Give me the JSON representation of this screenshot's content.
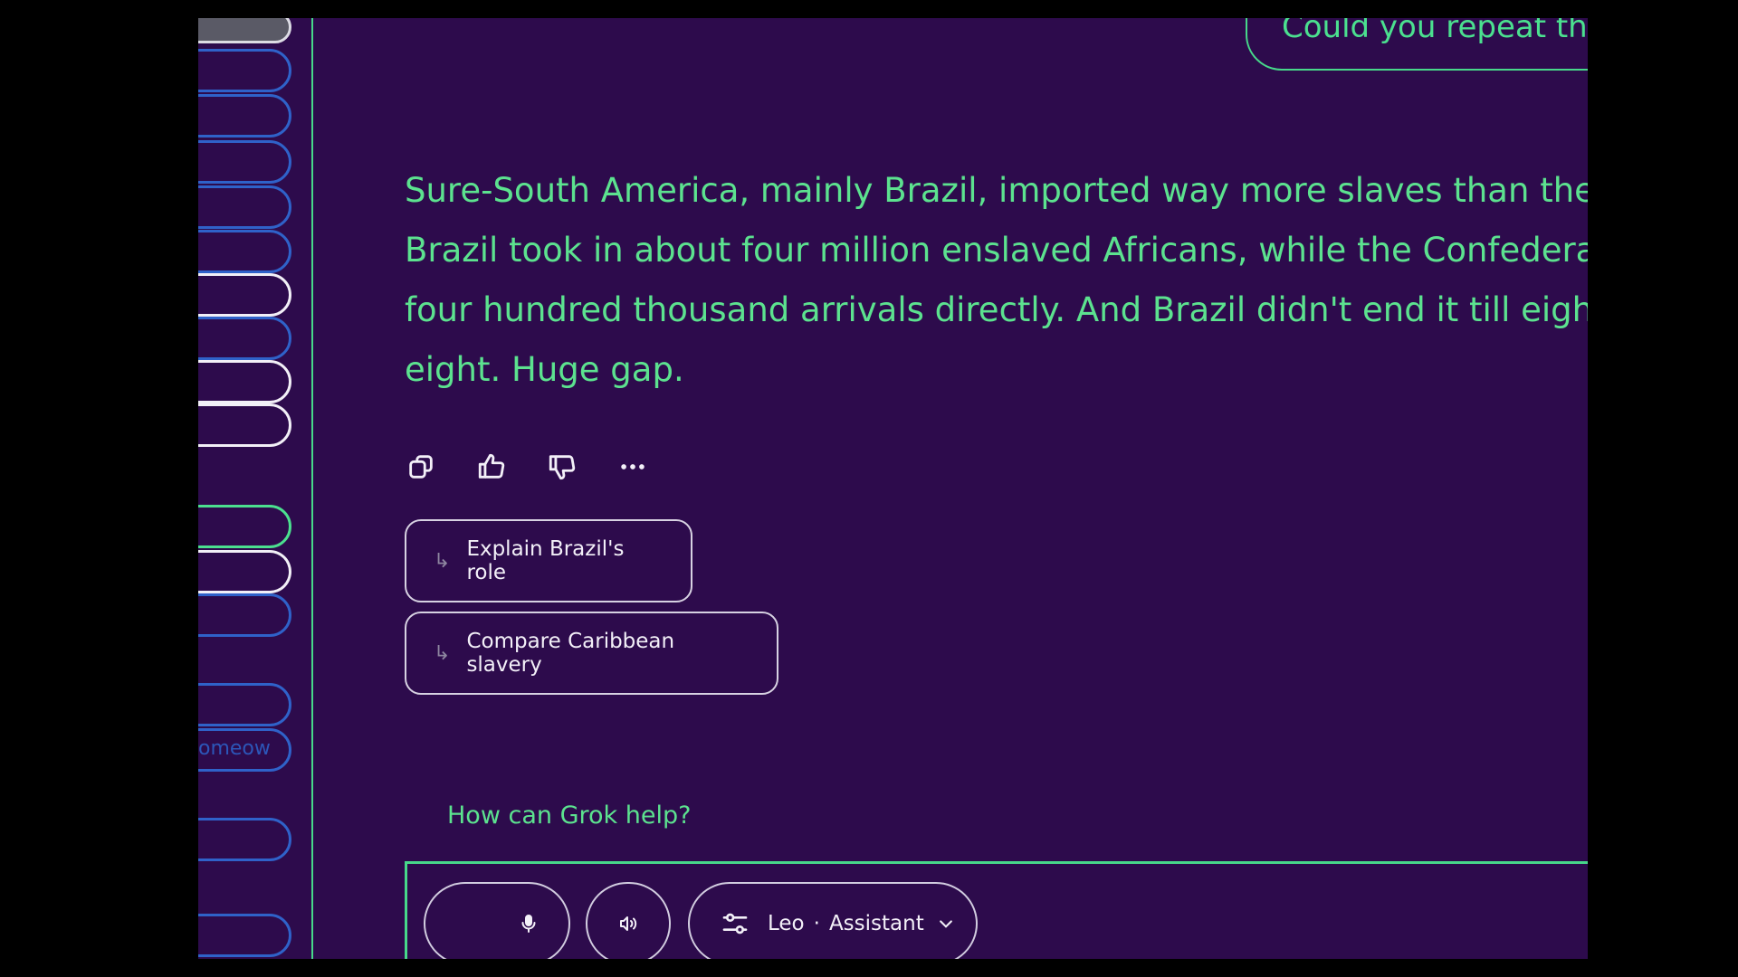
{
  "conversation": {
    "user_message": "Could you repeat th",
    "assistant_reply": [
      "Sure-South America, mainly Brazil, imported way more slaves than the Conf",
      "Brazil took in about four million enslaved Africans, while the Confederacy sa",
      "four hundred thousand arrivals directly. And Brazil didn't end it till eighteen",
      "eight. Huge gap."
    ]
  },
  "actions": {
    "copy_icon": "copy-icon",
    "like_icon": "thumbs-up-icon",
    "dislike_icon": "thumbs-down-icon",
    "more_icon": "more-icon"
  },
  "suggestions": [
    {
      "label": "Explain Brazil's role"
    },
    {
      "label": "Compare Caribbean slavery"
    }
  ],
  "composer": {
    "placeholder": "How can Grok help?",
    "persona": "Leo",
    "mode": "Assistant"
  },
  "sidebar": {
    "partial_label": "omeow"
  },
  "colors": {
    "background": "#2d0b4c",
    "accent_green": "#47d88a",
    "sidebar_blue": "#2f62c9"
  }
}
